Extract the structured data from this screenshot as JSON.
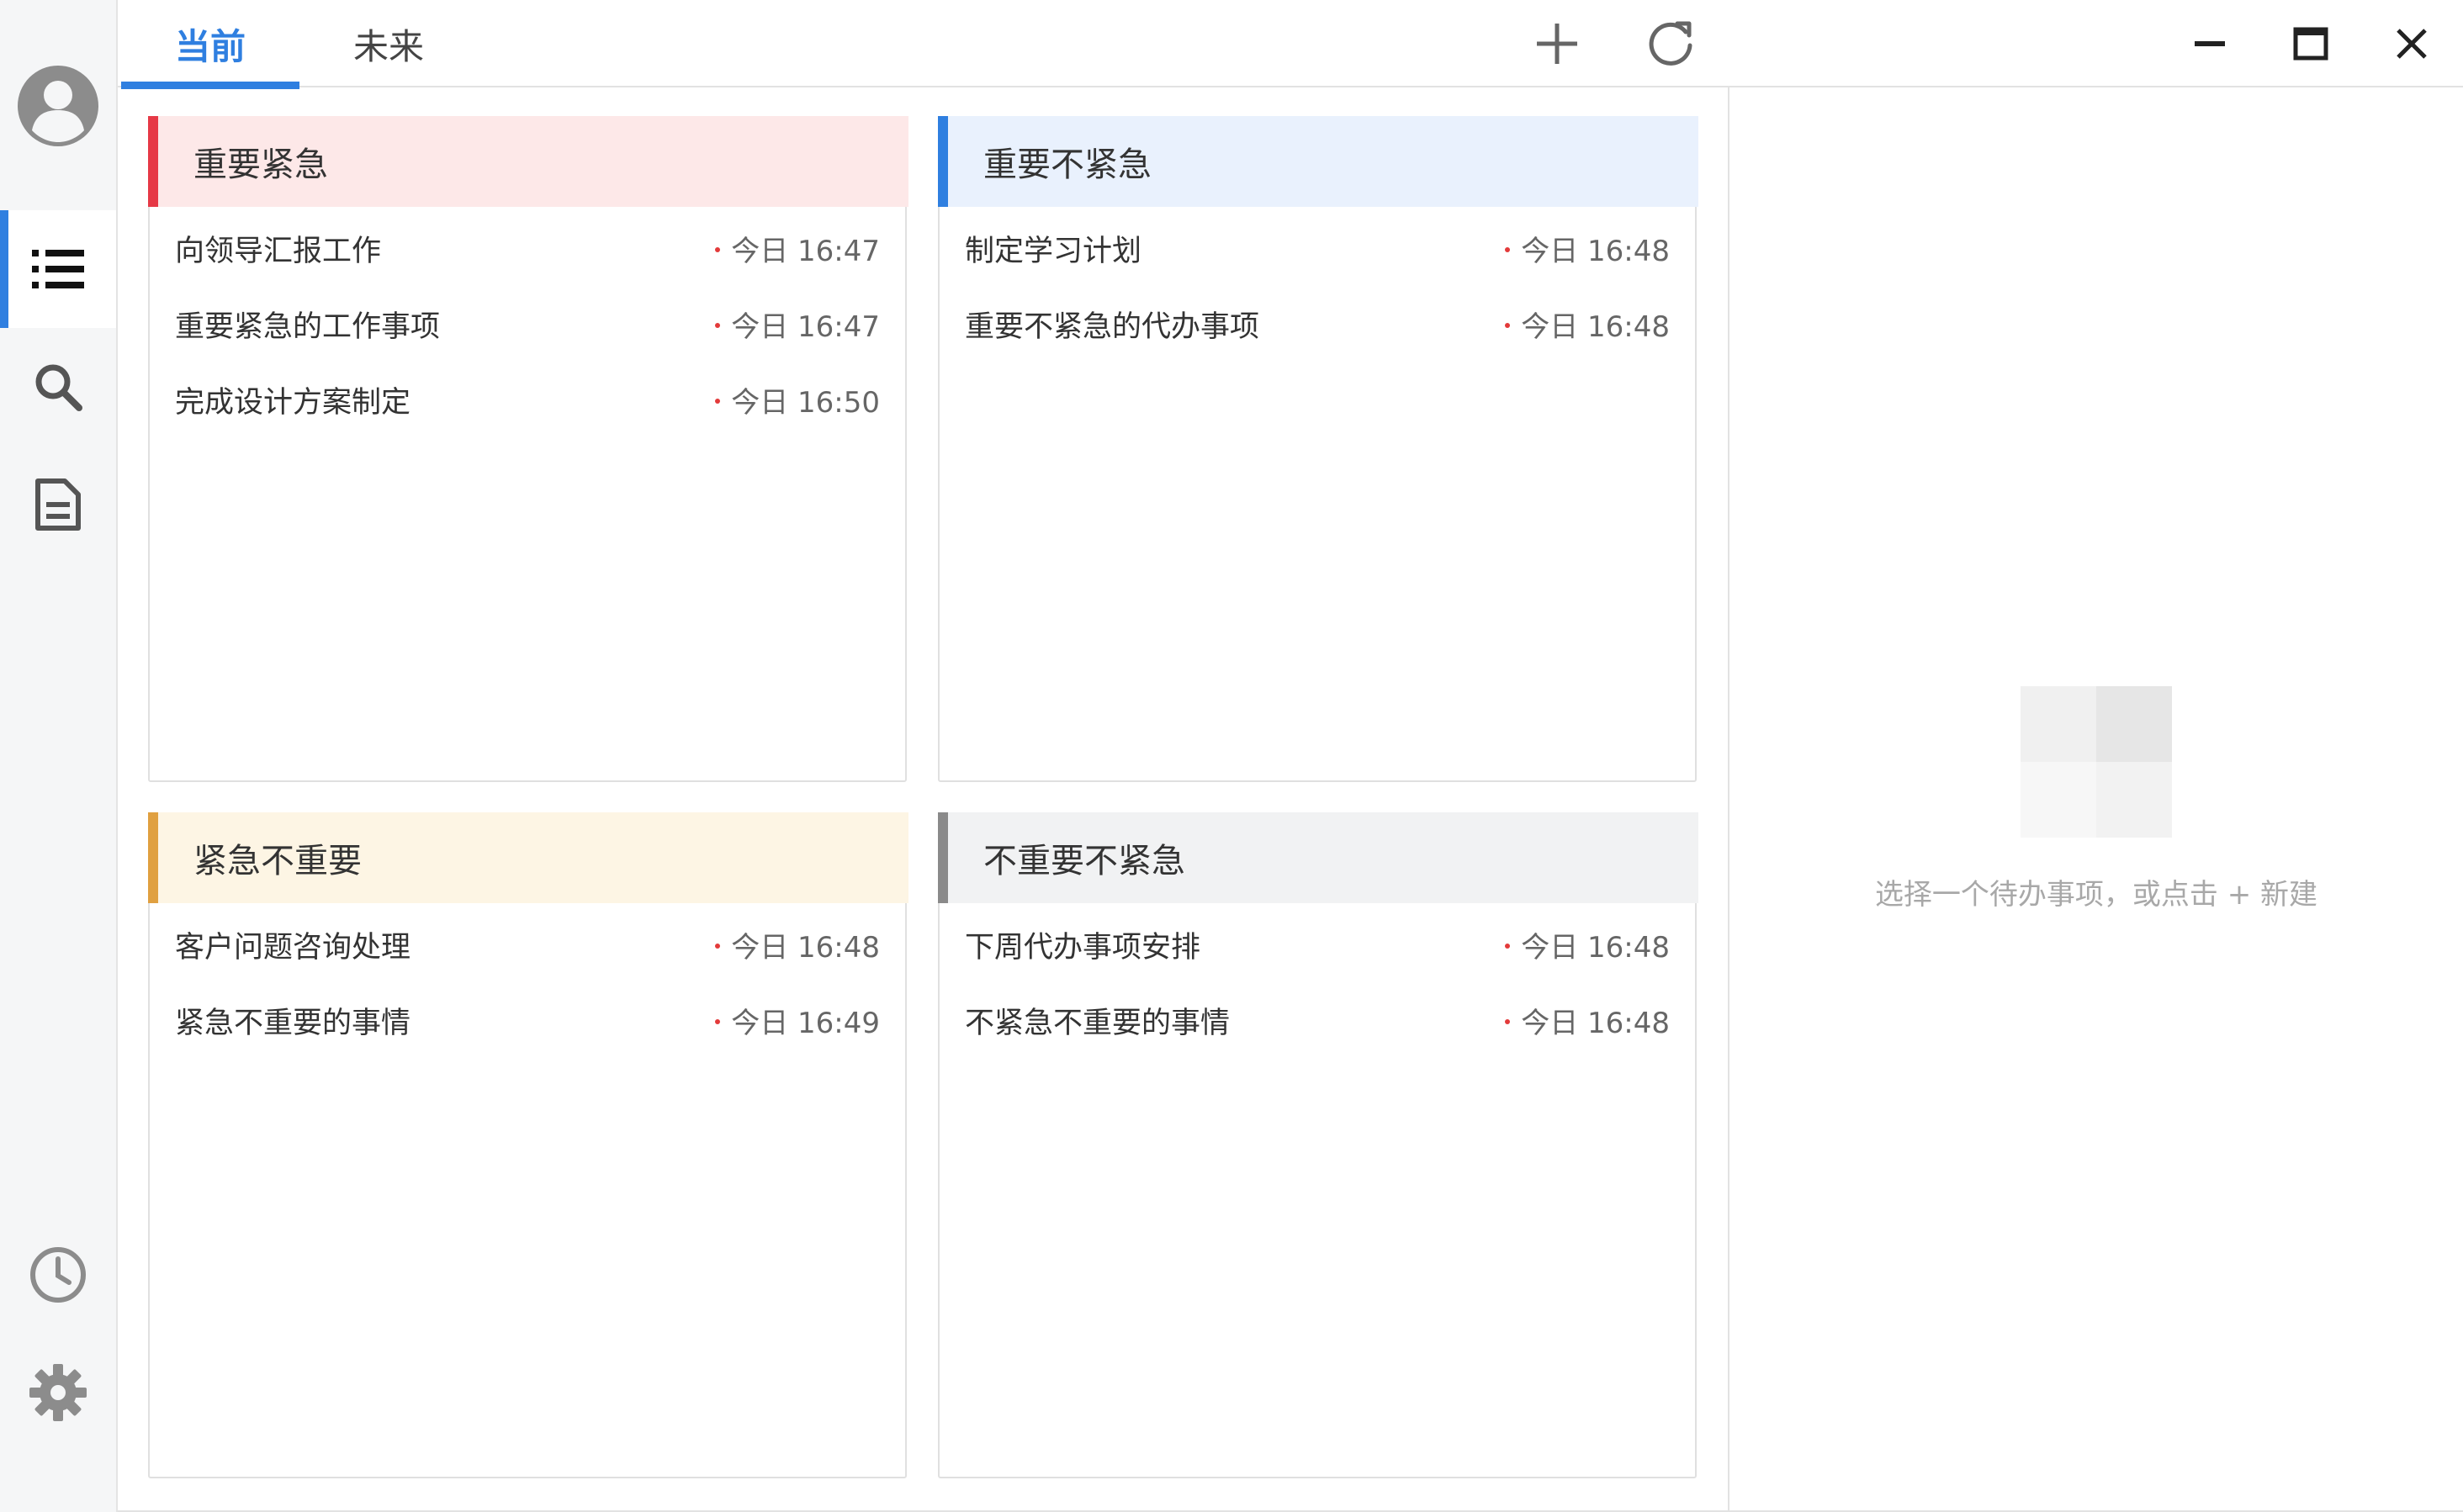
{
  "tabs": [
    {
      "label": "当前",
      "active": true
    },
    {
      "label": "未来",
      "active": false
    }
  ],
  "toolbar": {
    "add_icon": "plus-icon",
    "refresh_icon": "refresh-icon"
  },
  "window_controls": [
    "minimize-icon",
    "maximize-icon",
    "close-icon"
  ],
  "nav": {
    "items": [
      "avatar-icon",
      "list-icon",
      "search-icon",
      "document-icon",
      "history-icon",
      "settings-icon"
    ],
    "active": "list-icon"
  },
  "quadrants": [
    {
      "title": "重要紧急",
      "accent": "#e63946",
      "header_bg": "#fde8e8",
      "items": [
        {
          "text": "向领导汇报工作",
          "time": "今日 16:47"
        },
        {
          "text": "重要紧急的工作事项",
          "time": "今日 16:47"
        },
        {
          "text": "完成设计方案制定",
          "time": "今日 16:50"
        }
      ]
    },
    {
      "title": "重要不紧急",
      "accent": "#2f7fe0",
      "header_bg": "#e9f1fd",
      "items": [
        {
          "text": "制定学习计划",
          "time": "今日 16:48"
        },
        {
          "text": "重要不紧急的代办事项",
          "time": "今日 16:48"
        }
      ]
    },
    {
      "title": "紧急不重要",
      "accent": "#e0a040",
      "header_bg": "#fdf5e4",
      "items": [
        {
          "text": "客户问题咨询处理",
          "time": "今日 16:48"
        },
        {
          "text": "紧急不重要的事情",
          "time": "今日 16:49"
        }
      ]
    },
    {
      "title": "不重要不紧急",
      "accent": "#8a8a8a",
      "header_bg": "#f1f2f3",
      "items": [
        {
          "text": "下周代办事项安排",
          "time": "今日 16:48"
        },
        {
          "text": "不紧急不重要的事情",
          "time": "今日 16:48"
        }
      ]
    }
  ],
  "detail": {
    "empty_hint": "选择一个待办事项，或点击 + 新建"
  },
  "colors": {
    "accent": "#2f7fe0",
    "priority_dot": "#e33a3a",
    "muted_text": "#a8a8a8"
  }
}
